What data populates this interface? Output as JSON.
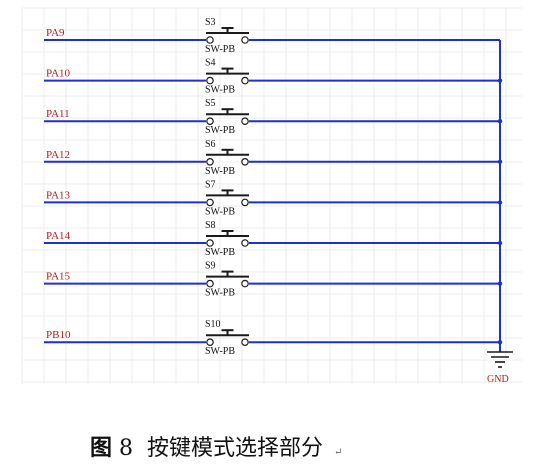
{
  "colors": {
    "wire": "#1f2fd0",
    "grid": "#eeeeee",
    "label": "#b02020",
    "component": "#1a1a1a"
  },
  "switches": [
    {
      "net": "PA9",
      "ref": "S3",
      "value": "SW-PB"
    },
    {
      "net": "PA10",
      "ref": "S4",
      "value": "SW-PB"
    },
    {
      "net": "PA11",
      "ref": "S5",
      "value": "SW-PB"
    },
    {
      "net": "PA12",
      "ref": "S6",
      "value": "SW-PB"
    },
    {
      "net": "PA13",
      "ref": "S7",
      "value": "SW-PB"
    },
    {
      "net": "PA14",
      "ref": "S8",
      "value": "SW-PB"
    },
    {
      "net": "PA15",
      "ref": "S9",
      "value": "SW-PB"
    },
    {
      "net": "PB10",
      "ref": "S10",
      "value": "SW-PB"
    }
  ],
  "ground": {
    "label": "GND"
  },
  "caption": {
    "prefix": "图",
    "number": "8",
    "text": "按键模式选择部分",
    "mark": "↵"
  }
}
